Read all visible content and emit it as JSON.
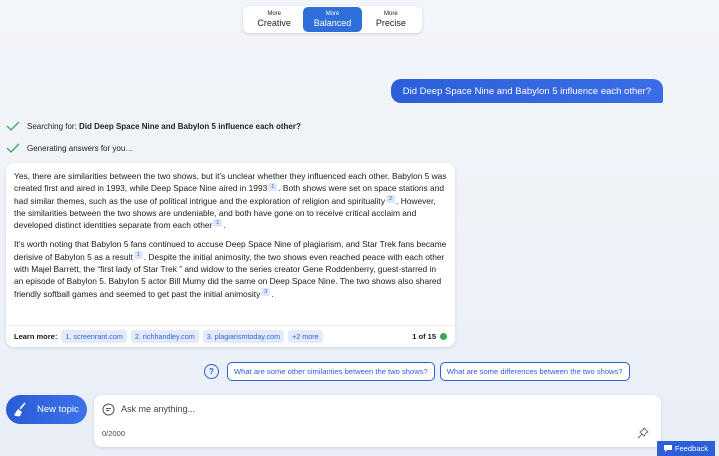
{
  "tone": {
    "options": [
      {
        "small": "More",
        "label": "Creative"
      },
      {
        "small": "More",
        "label": "Balanced"
      },
      {
        "small": "More",
        "label": "Precise"
      }
    ],
    "selected": "Balanced"
  },
  "user_message": "Did Deep Space Nine and Babylon 5 influence each other?",
  "status": {
    "searching_prefix": "Searching for: ",
    "searching_query": "Did Deep Space Nine and Babylon 5 influence each other?",
    "generating": "Generating answers for you…"
  },
  "answer": {
    "p1": {
      "t1": "Yes, there are similarities between the two shows, but it’s unclear whether they influenced each other. Babylon 5 was created first and aired in 1993, while Deep Space Nine aired in 1993",
      "c1": "1",
      "t2": ". Both shows were set on space stations and had similar themes, such as the use of political intrigue and the exploration of religion and spirituality",
      "c2": "2",
      "t3": ". However, the similarities between the two shows are undeniable, and both have gone on to receive critical acclaim and developed distinct identities separate from each other",
      "c3": "1",
      "t4": "."
    },
    "p2": {
      "t1": "It’s worth noting that Babylon 5 fans continued to accuse Deep Space Nine of plagiarism, and Star Trek fans became derisive of Babylon 5 as a result",
      "c1": "1",
      "t2": ". Despite the initial animosity, the two shows even reached peace with each other with Majel Barrett, the “first lady of Star Trek ” and widow to the series creator Gene Roddenberry, guest-starred in an episode of Babylon 5. Babylon 5 actor Bill Mumy did the same on Deep Space Nine. The two shows also shared friendly softball games and seemed to get past the initial animosity",
      "c2": "3",
      "t3": "."
    },
    "learn_more_label": "Learn more:",
    "sources": [
      "1. screenrant.com",
      "2. richhandley.com",
      "3. plagiarismtoday.com",
      "+2 more"
    ],
    "page_count": "1 of 15"
  },
  "suggestions": [
    "What are some other similarities between the two shows?",
    "What are some differences between the two shows?"
  ],
  "help_glyph": "?",
  "new_topic_label": "New topic",
  "input": {
    "placeholder": "Ask me anything...",
    "char_count": "0/2000"
  },
  "feedback_label": "Feedback",
  "colors": {
    "accent": "#2c5fd8",
    "status_dot": "#3aa859",
    "check": "#3aa859"
  },
  "icons": [
    "check-icon",
    "help-icon",
    "broom-icon",
    "chat-bubble-icon",
    "pin-icon",
    "feedback-icon"
  ]
}
